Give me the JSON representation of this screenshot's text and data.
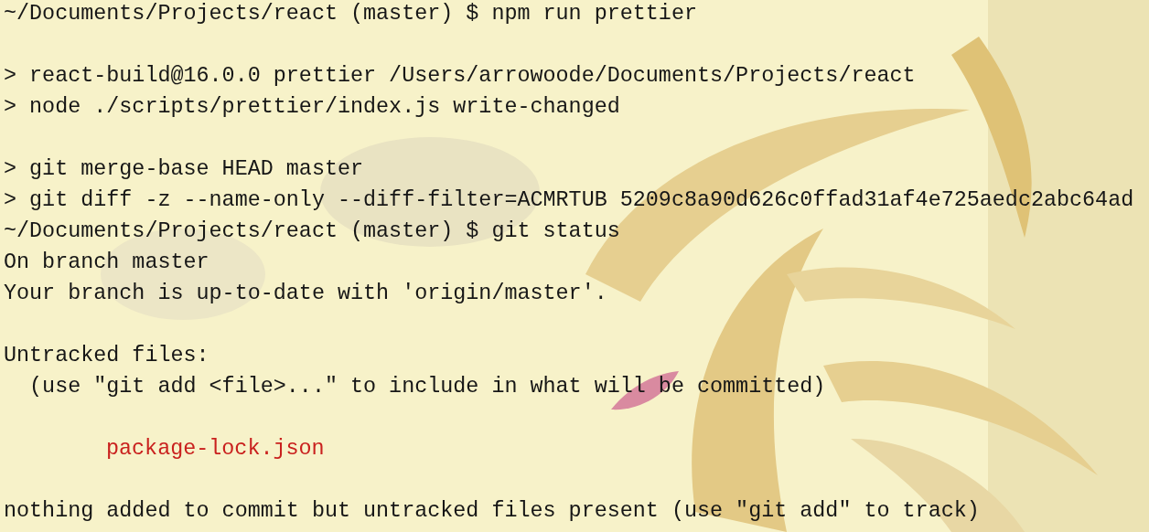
{
  "terminal": {
    "lines": [
      {
        "kind": "prompt",
        "text": "~/Documents/Projects/react (master) $ npm run prettier"
      },
      {
        "kind": "blank"
      },
      {
        "kind": "output",
        "text": "> react-build@16.0.0 prettier /Users/arrowoode/Documents/Projects/react"
      },
      {
        "kind": "output",
        "text": "> node ./scripts/prettier/index.js write-changed"
      },
      {
        "kind": "blank"
      },
      {
        "kind": "output",
        "text": "> git merge-base HEAD master"
      },
      {
        "kind": "output",
        "text": "> git diff -z --name-only --diff-filter=ACMRTUB 5209c8a90d626c0ffad31af4e725aedc2abc64ad"
      },
      {
        "kind": "prompt",
        "text": "~/Documents/Projects/react (master) $ git status"
      },
      {
        "kind": "output",
        "text": "On branch master"
      },
      {
        "kind": "output",
        "text": "Your branch is up-to-date with 'origin/master'."
      },
      {
        "kind": "blank"
      },
      {
        "kind": "output",
        "text": "Untracked files:"
      },
      {
        "kind": "output",
        "text": "  (use \"git add <file>...\" to include in what will be committed)"
      },
      {
        "kind": "blank"
      },
      {
        "kind": "untracked",
        "text": "package-lock.json"
      },
      {
        "kind": "blank"
      },
      {
        "kind": "output",
        "text": "nothing added to commit but untracked files present (use \"git add\" to track)"
      }
    ]
  }
}
